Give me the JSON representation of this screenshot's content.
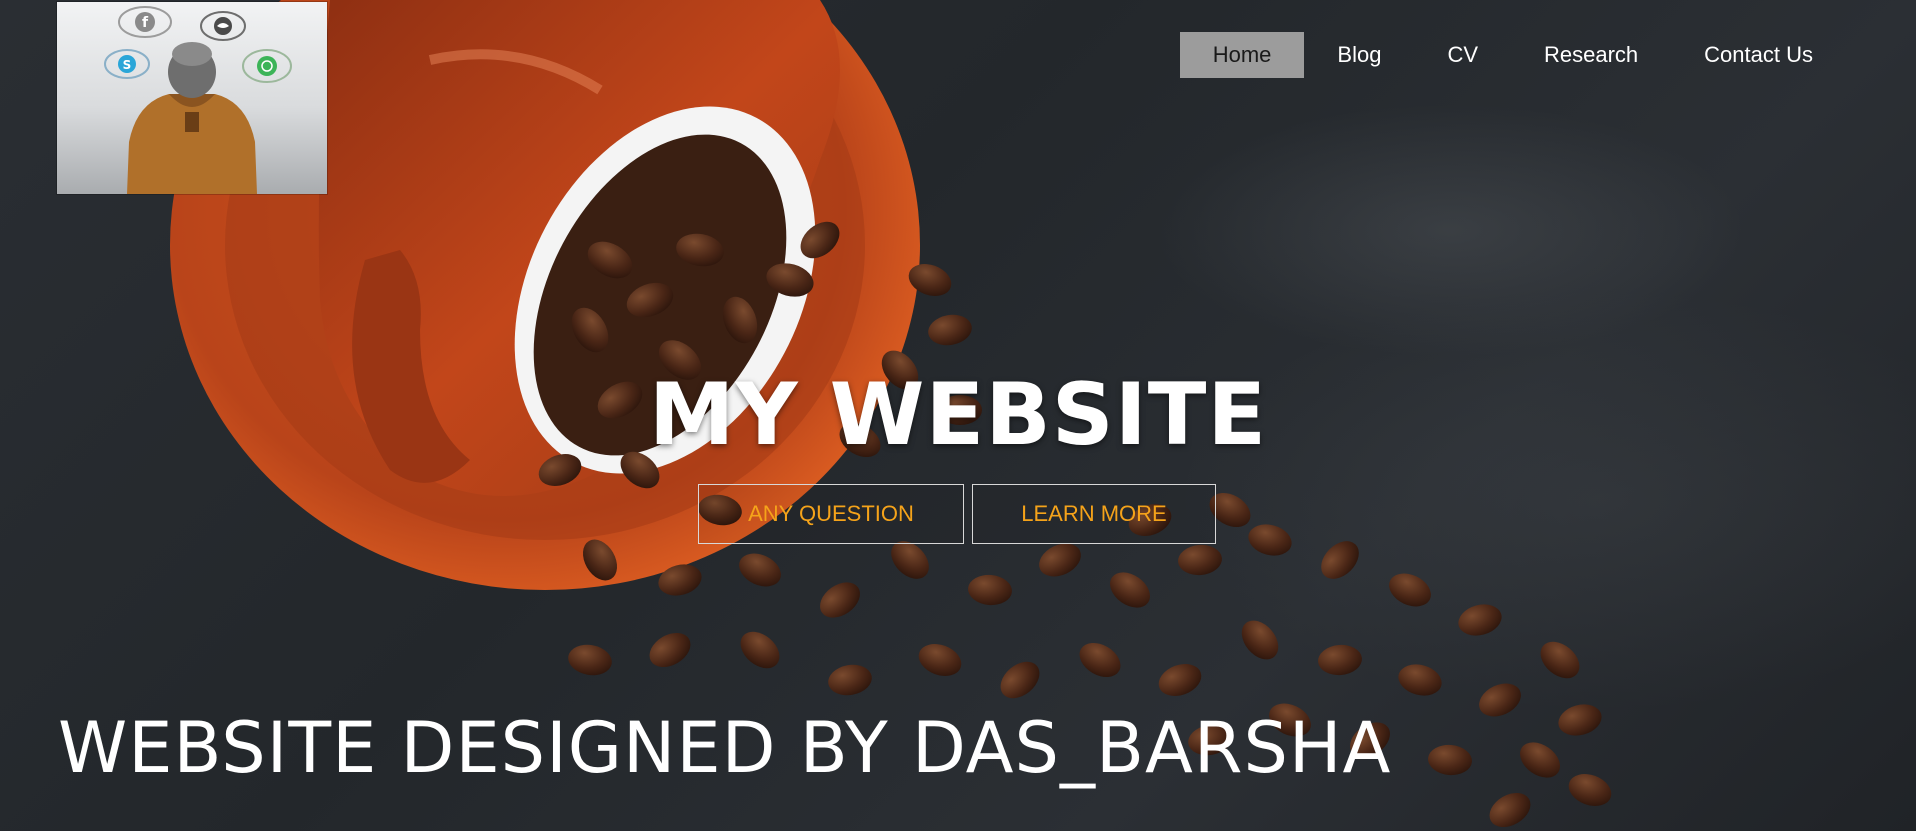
{
  "nav": {
    "items": [
      {
        "label": "Home",
        "active": true
      },
      {
        "label": "Blog",
        "active": false
      },
      {
        "label": "CV",
        "active": false
      },
      {
        "label": "Research",
        "active": false
      },
      {
        "label": "Contact Us",
        "active": false
      }
    ]
  },
  "logo": {
    "icons": [
      "facebook-icon",
      "twitter-icon",
      "skype-icon",
      "whatsapp-icon"
    ]
  },
  "hero": {
    "title": "MY WEBSITE",
    "buttons": {
      "question_label": "ANY QUESTION",
      "learn_label": "LEARN MORE"
    }
  },
  "footer": {
    "credit": "WEBSITE DESIGNED BY DAS_BARSHA"
  },
  "colors": {
    "accent": "#f5a31a",
    "nav_active_bg": "#9c9c9c",
    "cup": "#c4481a"
  }
}
